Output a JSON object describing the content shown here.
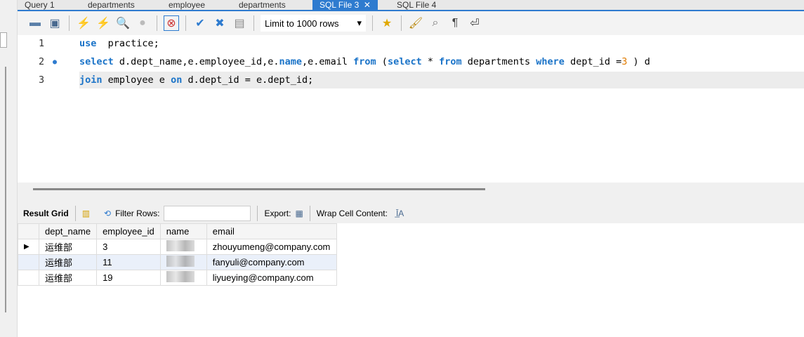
{
  "tabs": [
    "Query 1",
    "departments",
    "employee",
    "departments",
    "SQL File 3",
    "SQL File 4"
  ],
  "toolbar": {
    "limit": "Limit to 1000 rows",
    "icons": [
      "open-folder-icon",
      "save-icon",
      "execute-icon",
      "execute-current-icon",
      "explain-icon",
      "stop-icon",
      "toggle-continue-icon",
      "commit-icon",
      "rollback-icon",
      "autocommit-icon",
      "add-snippet-icon",
      "beautify-icon",
      "find-icon",
      "invisible-chars-icon",
      "wrap-icon"
    ]
  },
  "editor": {
    "lines": [
      {
        "n": "1",
        "tokens": [
          [
            "kw",
            "use"
          ],
          [
            "",
            "  practice;"
          ]
        ]
      },
      {
        "n": "2",
        "tokens": [
          [
            "kw",
            "select"
          ],
          [
            "",
            " d.dept_name,e.employee_id,e."
          ],
          [
            "kw",
            "name"
          ],
          [
            "",
            ",e.email "
          ],
          [
            "kw",
            "from"
          ],
          [
            "",
            " ("
          ],
          [
            "kw",
            "select"
          ],
          [
            "",
            " * "
          ],
          [
            "kw",
            "from"
          ],
          [
            "",
            " departments "
          ],
          [
            "kw",
            "where"
          ],
          [
            "",
            " dept_id ="
          ],
          [
            "num",
            "3"
          ],
          [
            "",
            " ) d"
          ]
        ]
      },
      {
        "n": "3",
        "tokens": [
          [
            "kw",
            "join"
          ],
          [
            "",
            " employee e "
          ],
          [
            "kw",
            "on"
          ],
          [
            "",
            " d.dept_id = e.dept_id;"
          ]
        ]
      }
    ]
  },
  "result": {
    "result_grid": "Result Grid",
    "filter_rows": "Filter Rows:",
    "export": "Export:",
    "wrap": "Wrap Cell Content:",
    "columns": [
      "dept_name",
      "employee_id",
      "name",
      "email"
    ],
    "rows": [
      [
        "运维部",
        "3",
        "",
        "zhouyumeng@company.com"
      ],
      [
        "运维部",
        "11",
        "",
        "fanyuli@company.com"
      ],
      [
        "运维部",
        "19",
        "",
        "liyueying@company.com"
      ]
    ]
  }
}
